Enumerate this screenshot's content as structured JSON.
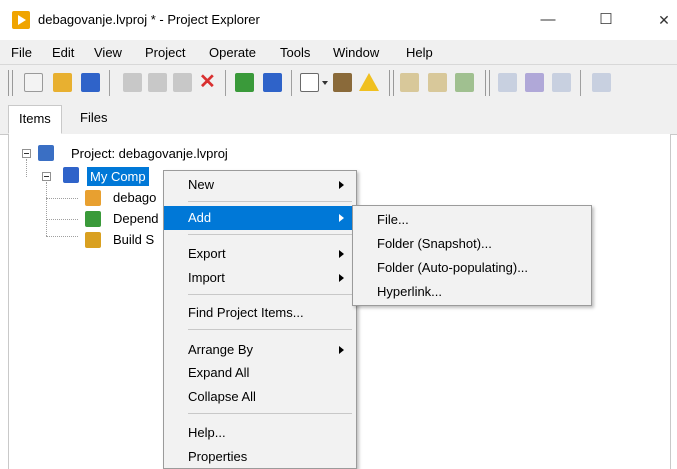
{
  "window": {
    "title": "debagovanje.lvproj * - Project Explorer",
    "minimize_glyph": "—",
    "maximize_glyph": "☐",
    "close_glyph": "✕"
  },
  "menubar": [
    "File",
    "Edit",
    "View",
    "Project",
    "Operate",
    "Tools",
    "Window",
    "Help"
  ],
  "toolbar": {
    "icons": [
      "new-icon",
      "open-icon",
      "save-all-icon",
      "cut-icon",
      "copy-icon",
      "paste-icon",
      "delete-icon",
      "build-icon",
      "deploy-icon",
      "view-icon",
      "target-icon",
      "warning-icon",
      "filter-icon",
      "sort-icon",
      "refresh-icon",
      "find-icon",
      "undo-icon",
      "redo-icon",
      "search-icon"
    ],
    "colors": {
      "folder": "#e8b030",
      "red": "#d93030",
      "blue": "#2f63c9",
      "green": "#3a9a3a",
      "gray": "#c8c8c8"
    }
  },
  "tabs": [
    "Items",
    "Files"
  ],
  "tree": {
    "project": "Project: debagovanje.lvproj",
    "computer": "My Comp",
    "children": [
      "debago",
      "Depend",
      "Build S"
    ]
  },
  "context_menu": {
    "items": [
      {
        "label": "New",
        "submenu": true
      },
      {
        "label": "Add",
        "submenu": true,
        "highlighted": true
      },
      {
        "label": "Export",
        "submenu": true
      },
      {
        "label": "Import",
        "submenu": true
      },
      {
        "label": "Find Project Items...",
        "submenu": false
      },
      {
        "label": "Arrange By",
        "submenu": true
      },
      {
        "label": "Expand All",
        "submenu": false
      },
      {
        "label": "Collapse All",
        "submenu": false
      },
      {
        "label": "Help...",
        "submenu": false
      },
      {
        "label": "Properties",
        "submenu": false
      }
    ]
  },
  "add_submenu": {
    "items": [
      "File...",
      "Folder (Snapshot)...",
      "Folder (Auto-populating)...",
      "Hyperlink..."
    ]
  },
  "accent_color": "#0078d7"
}
